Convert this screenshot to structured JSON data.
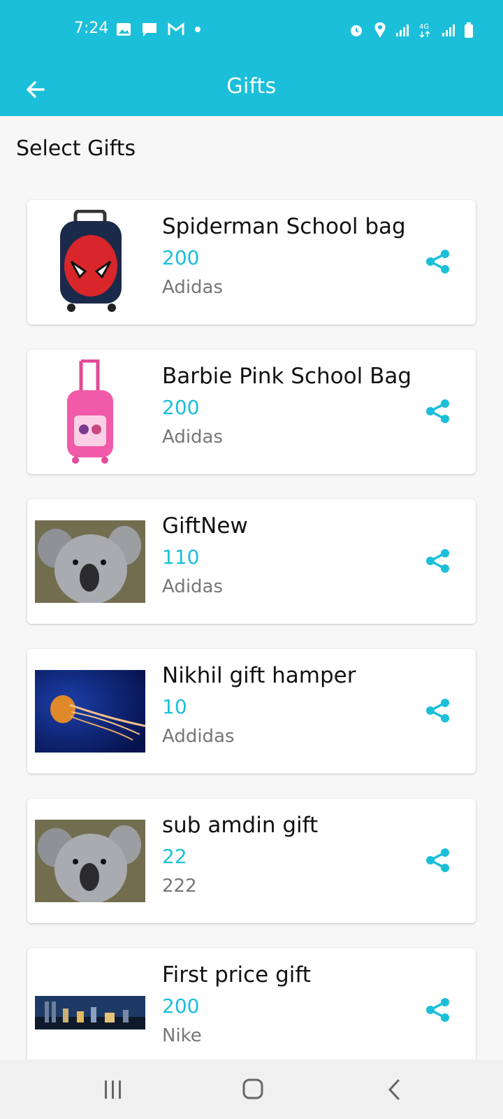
{
  "status": {
    "time": "7:24",
    "network": "4G",
    "left_icons": [
      "gallery-icon",
      "message-icon",
      "gmail-icon",
      "dot-icon"
    ],
    "right_icons": [
      "alarm-icon",
      "location-icon",
      "signal-icon",
      "4g-icon",
      "signal-icon",
      "battery-icon"
    ]
  },
  "appbar": {
    "title": "Gifts",
    "back_icon": "back-arrow-icon"
  },
  "section": {
    "title": "Select Gifts"
  },
  "accent_color": "#1bbfd9",
  "items": [
    {
      "name": "Spiderman School bag",
      "points": "200",
      "brand": "Adidas"
    },
    {
      "name": "Barbie Pink School Bag",
      "points": "200",
      "brand": "Adidas"
    },
    {
      "name": "GiftNew",
      "points": "110",
      "brand": "Adidas"
    },
    {
      "name": "Nikhil gift hamper",
      "points": "10",
      "brand": "Addidas"
    },
    {
      "name": "sub amdin gift",
      "points": "22",
      "brand": "222"
    },
    {
      "name": "First price gift",
      "points": "200",
      "brand": "Nike"
    }
  ],
  "navbar": {
    "icons": [
      "recent-apps-icon",
      "home-icon",
      "back-icon"
    ]
  }
}
